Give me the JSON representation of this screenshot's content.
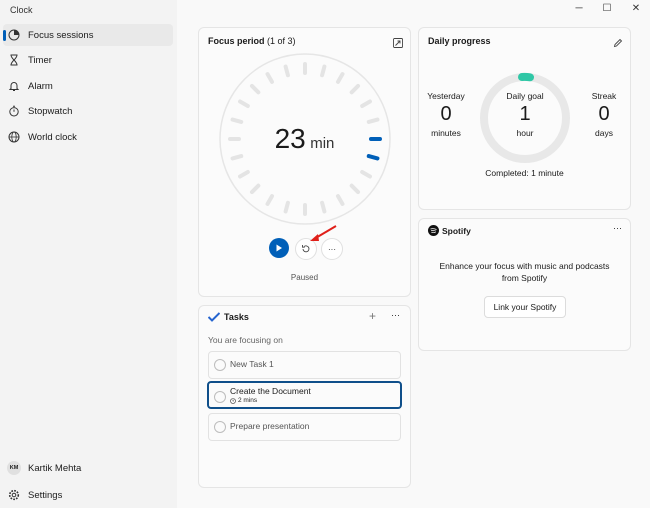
{
  "app": {
    "title": "Clock"
  },
  "window": {
    "minimize": "─",
    "maximize": "☐",
    "close": "✕"
  },
  "sidebar": {
    "items": [
      {
        "label": "Focus sessions",
        "icon": "focus-icon",
        "active": true
      },
      {
        "label": "Timer",
        "icon": "hourglass-icon"
      },
      {
        "label": "Alarm",
        "icon": "bell-icon"
      },
      {
        "label": "Stopwatch",
        "icon": "stopwatch-icon"
      },
      {
        "label": "World clock",
        "icon": "globe-icon"
      }
    ],
    "user": {
      "initials": "KM",
      "name": "Kartik Mehta"
    },
    "settings": "Settings"
  },
  "focus": {
    "title": "Focus period",
    "period": "(1 of 3)",
    "minutes": "23",
    "unit": "min",
    "status": "Paused",
    "more": "···"
  },
  "progress": {
    "title": "Daily progress",
    "yesterday_label": "Yesterday",
    "yesterday_value": "0",
    "yesterday_unit": "minutes",
    "goal_label": "Daily goal",
    "goal_value": "1",
    "goal_unit": "hour",
    "streak_label": "Streak",
    "streak_value": "0",
    "streak_unit": "days",
    "completed": "Completed: 1 minute"
  },
  "spotify": {
    "brand": "Spotify",
    "message": "Enhance your focus with music and podcasts from Spotify",
    "link_button": "Link your Spotify",
    "more": "···"
  },
  "tasks": {
    "title": "Tasks",
    "add": "+",
    "more": "···",
    "subtitle": "You are focusing on",
    "items": [
      {
        "label": "New Task 1"
      },
      {
        "label": "Create the Document",
        "meta": "2 mins",
        "selected": true
      },
      {
        "label": "Prepare presentation"
      }
    ]
  },
  "colors": {
    "accent": "#005fb8",
    "teal": "#2fc7a6",
    "spotify": "#1db954"
  }
}
